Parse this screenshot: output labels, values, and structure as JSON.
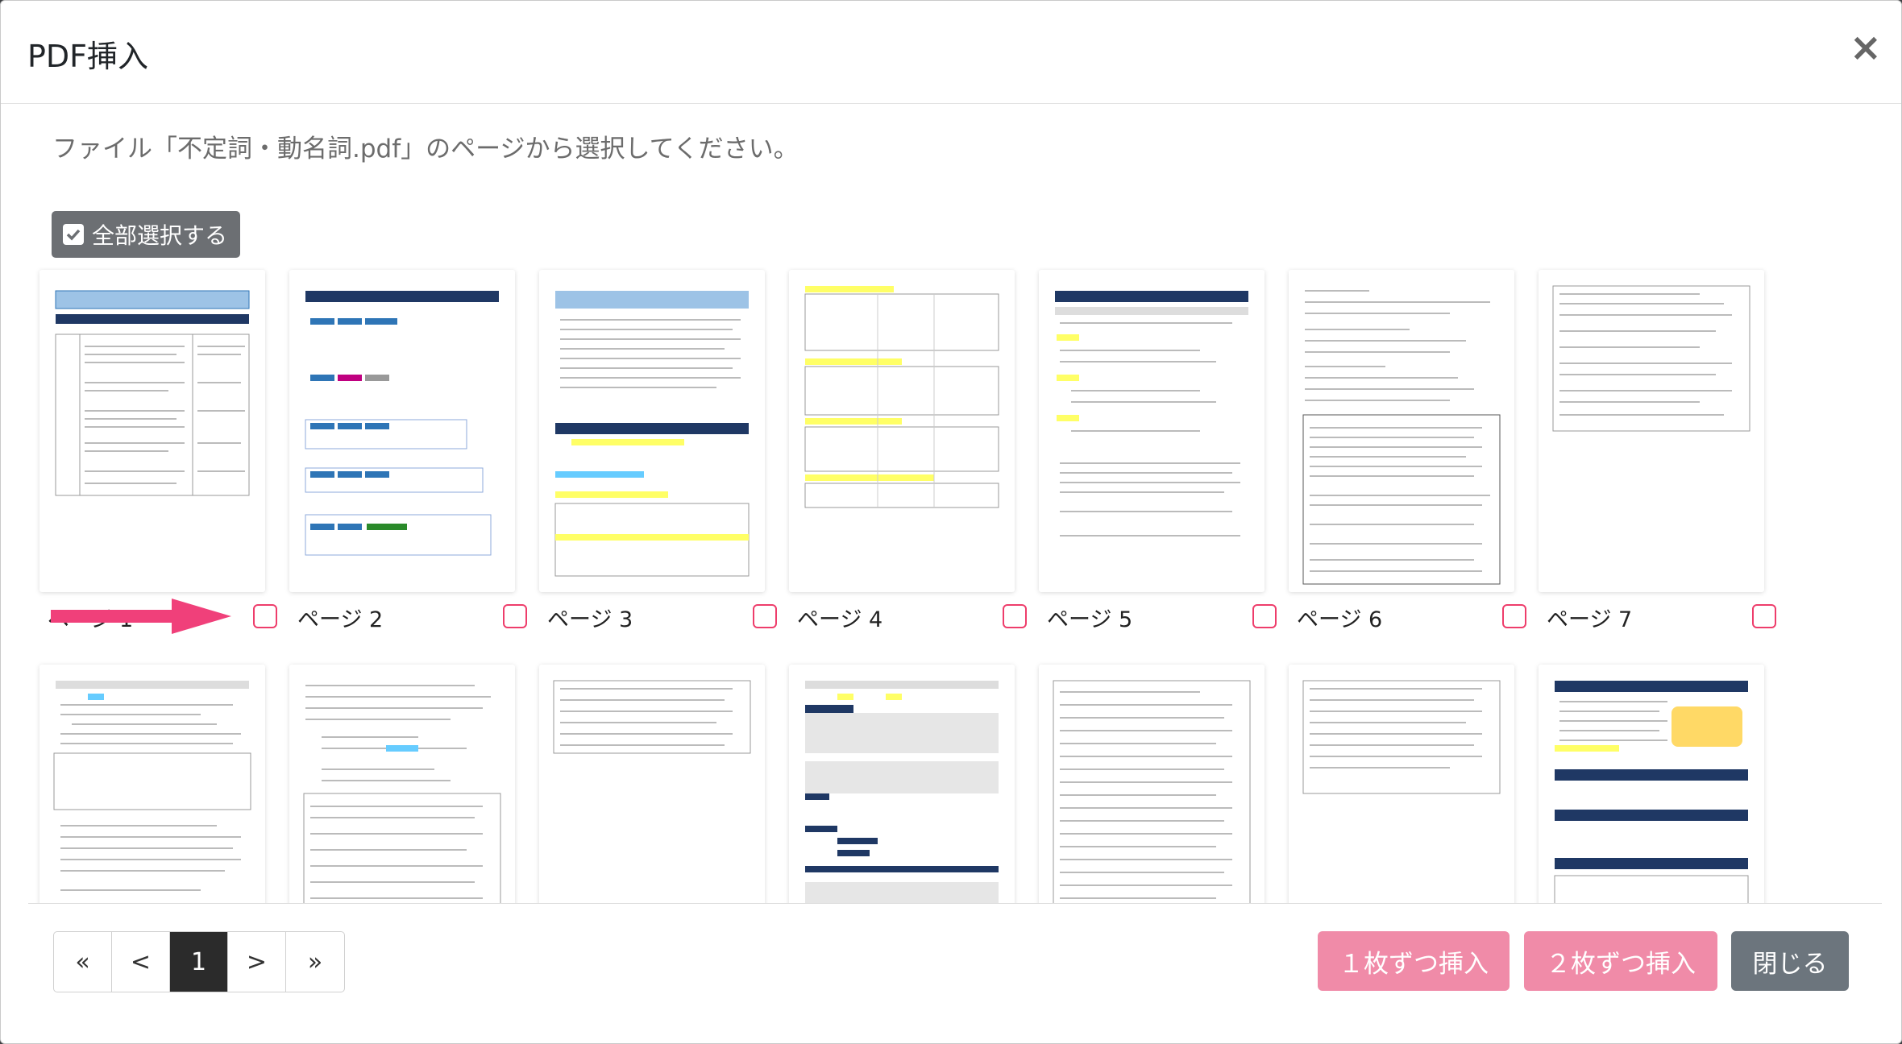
{
  "header": {
    "title": "PDF挿入",
    "close": "×"
  },
  "instruction": "ファイル「不定詞・動名詞.pdf」のページから選択してください。",
  "select_all_label": "全部選択する",
  "pages": [
    {
      "label": "ページ 1"
    },
    {
      "label": "ページ 2"
    },
    {
      "label": "ページ 3"
    },
    {
      "label": "ページ 4"
    },
    {
      "label": "ページ 5"
    },
    {
      "label": "ページ 6"
    },
    {
      "label": "ページ 7"
    }
  ],
  "pagination": {
    "first": "«",
    "prev": "<",
    "current": "1",
    "next": ">",
    "last": "»"
  },
  "footer": {
    "insert_one": "１枚ずつ挿入",
    "insert_two": "２枚ずつ挿入",
    "close": "閉じる"
  },
  "colors": {
    "accent_pink": "#ee3d6b",
    "button_pink": "#f08ba8",
    "button_gray": "#6c757d",
    "doc_navy": "#1f3864"
  }
}
